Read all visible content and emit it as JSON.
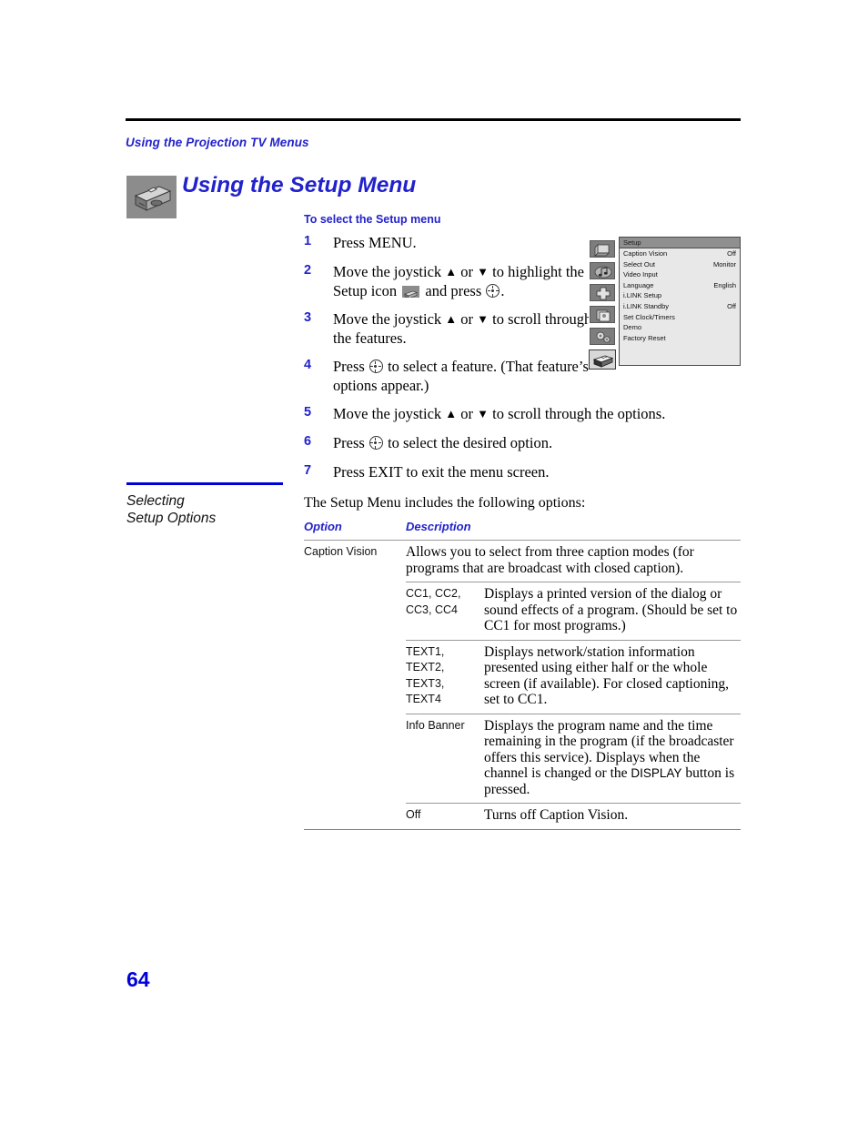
{
  "running_head": "Using the Projection TV Menus",
  "heading": {
    "title": "Using the Setup Menu",
    "icon": "toolbox-icon"
  },
  "procedure": {
    "heading": "To select the Setup menu",
    "steps": [
      {
        "num": "1",
        "parts": [
          "Press MENU."
        ]
      },
      {
        "num": "2",
        "parts": [
          "Move the joystick ",
          "up-arrow",
          " or ",
          "down-arrow",
          " to highlight the Setup icon ",
          "setup-icon",
          " and press ",
          "select-icon",
          "."
        ]
      },
      {
        "num": "3",
        "parts": [
          "Move the joystick ",
          "up-arrow",
          " or ",
          "down-arrow",
          " to scroll through the features."
        ]
      },
      {
        "num": "4",
        "parts": [
          "Press ",
          "select-icon",
          " to select a feature. (That feature’s options appear.)"
        ]
      },
      {
        "num": "5",
        "parts": [
          "Move the joystick ",
          "up-arrow",
          " or ",
          "down-arrow",
          " to scroll through the options."
        ]
      },
      {
        "num": "6",
        "parts": [
          "Press ",
          "select-icon",
          " to select the desired option."
        ]
      },
      {
        "num": "7",
        "parts": [
          "Press EXIT to exit the menu screen."
        ]
      }
    ],
    "step1_text": "Press MENU.",
    "step2_a": "Move the joystick ",
    "step2_b": " or ",
    "step2_c": " to highlight the Setup icon ",
    "step2_d": " and press ",
    "step2_e": ".",
    "step3_a": "Move the joystick ",
    "step3_b": " or ",
    "step3_c": " to scroll through the features.",
    "step4_a": "Press ",
    "step4_b": " to select a feature. (That feature’s options appear.)",
    "step5_a": "Move the joystick ",
    "step5_b": " or ",
    "step5_c": " to scroll through the options.",
    "step6_a": "Press ",
    "step6_b": " to select the desired option.",
    "step7_text": "Press EXIT to exit the menu screen."
  },
  "tv_menu": {
    "title": "Setup",
    "icons": [
      "video-screen-icon",
      "audio-note-icon",
      "channel-plus-icon",
      "picture-cards-icon",
      "settings-gears-icon",
      "setup-toolbox-icon"
    ],
    "selected_icon_index": 5,
    "rows": [
      {
        "label": "Caption Vision",
        "value": "Off"
      },
      {
        "label": "Select Out",
        "value": "Monitor"
      },
      {
        "label": "Video Input",
        "value": ""
      },
      {
        "label": "Language",
        "value": "English"
      },
      {
        "label": "i.LINK Setup",
        "value": ""
      },
      {
        "label": "i.LINK Standby",
        "value": "Off"
      },
      {
        "label": "Set Clock/Timers",
        "value": ""
      },
      {
        "label": "Demo",
        "value": ""
      },
      {
        "label": "Factory Reset",
        "value": ""
      }
    ]
  },
  "side_heading": {
    "line1": "Selecting",
    "line2": "Setup Options"
  },
  "intro": "The Setup Menu includes the following options:",
  "table": {
    "headers": {
      "option": "Option",
      "description": "Description"
    },
    "main_row": {
      "option": "Caption Vision",
      "description": "Allows you to select from three caption modes (for programs that are broadcast with closed caption)."
    },
    "sub_rows": [
      {
        "option": "CC1, CC2, CC3, CC4",
        "description": "Displays a printed version of the dialog or sound effects of a program. (Should be set to CC1 for most programs.)"
      },
      {
        "option": "TEXT1, TEXT2, TEXT3, TEXT4",
        "description": "Displays network/station information presented using either half or the whole screen (if available). For closed captioning, set to CC1."
      },
      {
        "option": "Info Banner",
        "description_a": "Displays the program name and the time remaining in the program (if the broadcaster offers this service). Displays when the channel is changed or the ",
        "description_button": "DISPLAY",
        "description_b": " button is pressed."
      },
      {
        "option": "Off",
        "description": "Turns off Caption Vision."
      }
    ]
  },
  "folio": "64",
  "colors": {
    "heading_blue": "#2222CC",
    "rule_blue": "#0000DD",
    "rule_gray": "#9a9a9a"
  }
}
